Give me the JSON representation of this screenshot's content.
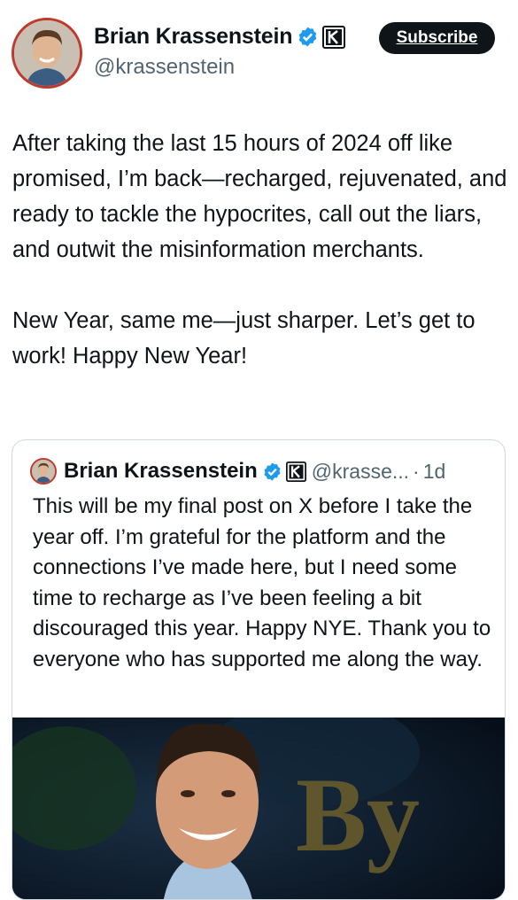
{
  "author": {
    "name": "Brian Krassenstein",
    "handle": "@krassenstein",
    "verified_icon": "verified-badge-icon",
    "org_icon": "k-org-badge-icon"
  },
  "actions": {
    "subscribe_label": "Subscribe"
  },
  "post": {
    "text": "After taking the last 15 hours of 2024 off like promised,  I’m back—recharged, rejuvenated, and ready to tackle the hypocrites, call out the liars, and outwit the misinformation merchants.\n\nNew Year, same me—just sharper. Let’s get to work! Happy New Year!"
  },
  "quoted_post": {
    "author_name": "Brian Krassenstein",
    "handle": "@krasse...",
    "separator": "·",
    "time": "1d",
    "text": "This will be my final post on X before I take the year off. I’m grateful for the platform and the connections I’ve made here, but I need some time to recharge as I’ve been feeling a bit discouraged this year. Happy NYE. Thank you to everyone who has supported me along the way.",
    "media_watermark": "By"
  },
  "colors": {
    "text": "#0f1419",
    "secondary": "#536471",
    "verified": "#1d9bf0",
    "avatar_ring": "#c0392b"
  }
}
